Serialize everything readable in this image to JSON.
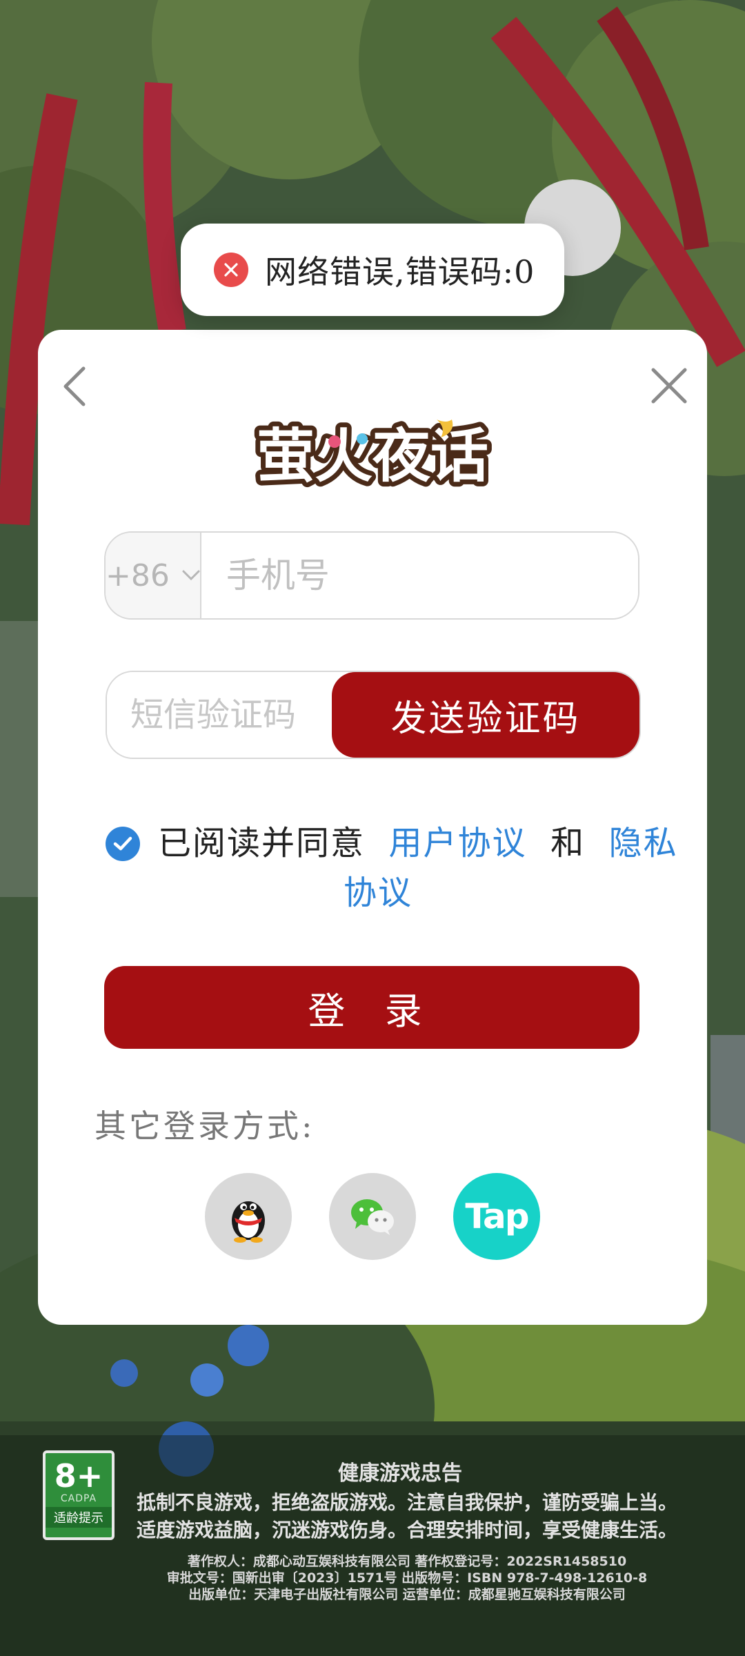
{
  "toast": {
    "icon": "close-icon",
    "message": "网络错误,错误码:0"
  },
  "dialog": {
    "logo_text": "萤火夜话",
    "phone": {
      "country_code": "+86",
      "placeholder": "手机号"
    },
    "sms": {
      "placeholder": "短信验证码",
      "send_button": "发送验证码"
    },
    "agreement": {
      "checked": true,
      "prefix": "已阅读并同意",
      "user_agreement": "用户协议",
      "and": "和",
      "privacy_part1": "隐私",
      "privacy_part2": "协议"
    },
    "login_button": "登 录",
    "other_methods_label": "其它登录方式:",
    "social": [
      {
        "name": "qq",
        "icon": "qq-penguin-icon"
      },
      {
        "name": "wechat",
        "icon": "wechat-icon"
      },
      {
        "name": "taptap",
        "label": "Tap"
      }
    ]
  },
  "footer": {
    "age_rating": "8+",
    "age_org": "CADPA",
    "age_tip": "适龄提示",
    "title": "健康游戏忠告",
    "line1": "抵制不良游戏，拒绝盗版游戏。注意自我保护，谨防受骗上当。",
    "line2": "适度游戏益脑，沉迷游戏伤身。合理安排时间，享受健康生活。",
    "small1": "著作权人：成都心动互娱科技有限公司    著作权登记号：2022SR1458510",
    "small2": "审批文号：国新出审〔2023〕1571号    出版物号：ISBN 978-7-498-12610-8",
    "small3": "出版单位：天津电子出版社有限公司    运营单位：成都星驰互娱科技有限公司"
  },
  "colors": {
    "primary": "#a50f12",
    "link": "#2f84d8",
    "tap": "#17d2c8",
    "error": "#e84b4b"
  }
}
